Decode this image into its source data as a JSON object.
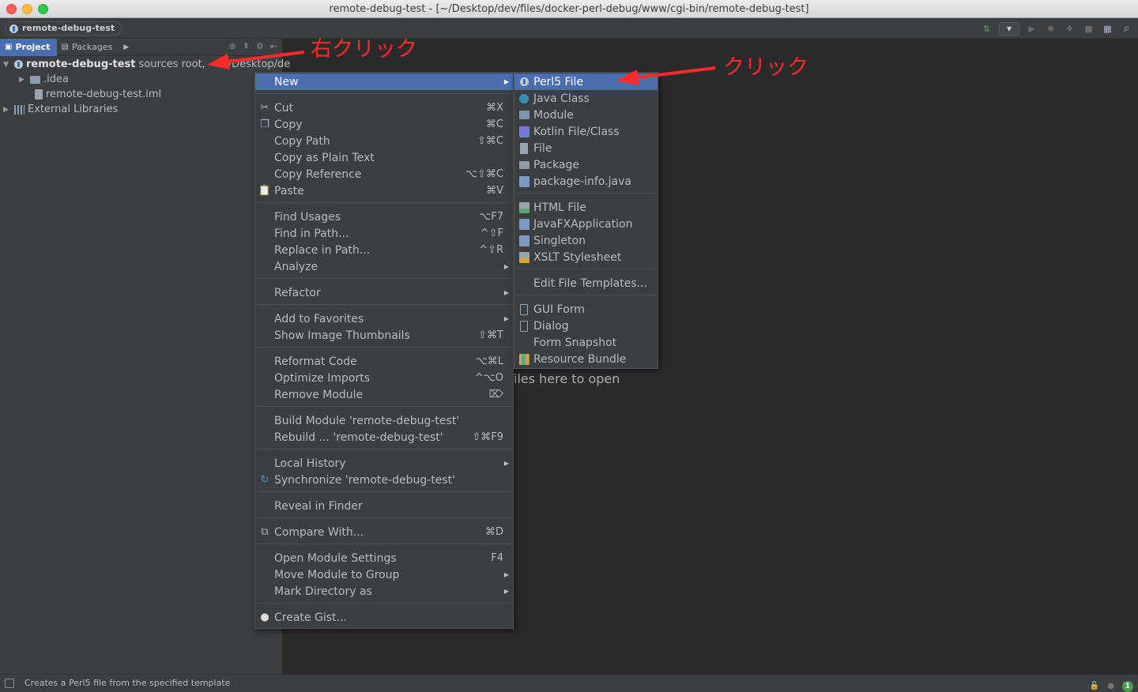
{
  "window": {
    "title": "remote-debug-test - [~/Desktop/dev/files/docker-perl-debug/www/cgi-bin/remote-debug-test]"
  },
  "navbar": {
    "breadcrumb": "remote-debug-test"
  },
  "project_panel": {
    "tabs": [
      {
        "label": "Project"
      },
      {
        "label": "Packages"
      }
    ],
    "tree": {
      "root_name": "remote-debug-test",
      "root_suffix": "sources root,",
      "root_path": "~/Desktop/de",
      "items": [
        {
          "label": ".idea"
        },
        {
          "label": "remote-debug-test.iml"
        },
        {
          "label": "External Libraries"
        }
      ]
    }
  },
  "editor": {
    "hint": "iles here to open"
  },
  "context_menu": {
    "items": [
      {
        "label": "New",
        "shortcut": ""
      },
      {
        "label": "Cut",
        "shortcut": "⌘X"
      },
      {
        "label": "Copy",
        "shortcut": "⌘C"
      },
      {
        "label": "Copy Path",
        "shortcut": "⇧⌘C"
      },
      {
        "label": "Copy as Plain Text",
        "shortcut": ""
      },
      {
        "label": "Copy Reference",
        "shortcut": "⌥⇧⌘C"
      },
      {
        "label": "Paste",
        "shortcut": "⌘V"
      },
      {
        "label": "Find Usages",
        "shortcut": "⌥F7"
      },
      {
        "label": "Find in Path...",
        "shortcut": "^⇧F"
      },
      {
        "label": "Replace in Path...",
        "shortcut": "^⇧R"
      },
      {
        "label": "Analyze",
        "shortcut": ""
      },
      {
        "label": "Refactor",
        "shortcut": ""
      },
      {
        "label": "Add to Favorites",
        "shortcut": ""
      },
      {
        "label": "Show Image Thumbnails",
        "shortcut": "⇧⌘T"
      },
      {
        "label": "Reformat Code",
        "shortcut": "⌥⌘L"
      },
      {
        "label": "Optimize Imports",
        "shortcut": "^⌥O"
      },
      {
        "label": "Remove Module",
        "shortcut": "⌦"
      },
      {
        "label": "Build Module 'remote-debug-test'",
        "shortcut": ""
      },
      {
        "label": "Rebuild ... 'remote-debug-test'",
        "shortcut": "⇧⌘F9"
      },
      {
        "label": "Local History",
        "shortcut": ""
      },
      {
        "label": "Synchronize 'remote-debug-test'",
        "shortcut": ""
      },
      {
        "label": "Reveal in Finder",
        "shortcut": ""
      },
      {
        "label": "Compare With...",
        "shortcut": "⌘D"
      },
      {
        "label": "Open Module Settings",
        "shortcut": "F4"
      },
      {
        "label": "Move Module to Group",
        "shortcut": ""
      },
      {
        "label": "Mark Directory as",
        "shortcut": ""
      },
      {
        "label": "Create Gist...",
        "shortcut": ""
      }
    ]
  },
  "new_submenu": {
    "items": [
      {
        "label": "Perl5 File"
      },
      {
        "label": "Java Class"
      },
      {
        "label": "Module"
      },
      {
        "label": "Kotlin File/Class"
      },
      {
        "label": "File"
      },
      {
        "label": "Package"
      },
      {
        "label": "package-info.java"
      },
      {
        "label": "HTML File"
      },
      {
        "label": "JavaFXApplication"
      },
      {
        "label": "Singleton"
      },
      {
        "label": "XSLT Stylesheet"
      },
      {
        "label": "Edit File Templates..."
      },
      {
        "label": "GUI Form"
      },
      {
        "label": "Dialog"
      },
      {
        "label": "Form Snapshot"
      },
      {
        "label": "Resource Bundle"
      }
    ]
  },
  "status_bar": {
    "text": "Creates a Perl5 file from the specified template",
    "badge": "1"
  },
  "annotations": {
    "right_click": "右クリック",
    "click": "クリック"
  },
  "colors": {
    "selection": "#4b6eaf",
    "annotation": "#ff2a2a",
    "panel_bg": "#3c3f41",
    "editor_bg": "#2b2b2b"
  }
}
